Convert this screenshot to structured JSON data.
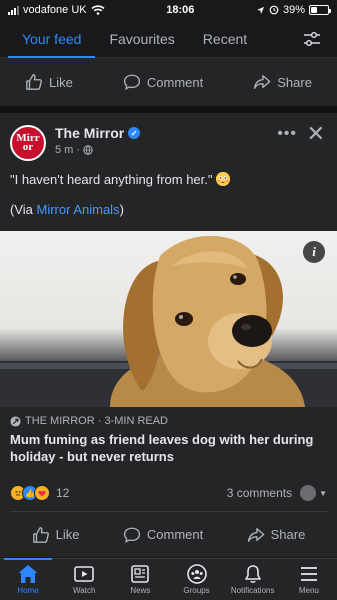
{
  "status_bar": {
    "carrier": "vodafone UK",
    "time": "18:06",
    "battery": "39%",
    "battery_level": 0.39
  },
  "tabs": [
    {
      "label": "Your feed",
      "active": true
    },
    {
      "label": "Favourites",
      "active": false
    },
    {
      "label": "Recent",
      "active": false
    }
  ],
  "actions": {
    "like": "Like",
    "comment": "Comment",
    "share": "Share"
  },
  "post": {
    "author": "The Mirror",
    "avatar_text": "Mirr\nor",
    "time": "5 m",
    "quote": "\"I haven't heard anything from her.\"",
    "via_prefix": "(Via ",
    "via_link": "Mirror Animals",
    "via_suffix": ")",
    "link_source": "THE MIRROR · 3-MIN READ",
    "headline": "Mum fuming as friend leaves dog with her during holiday - but never returns",
    "reaction_count": "12",
    "comments": "3 comments"
  },
  "bottom_nav": [
    {
      "label": "Home",
      "icon": "home-icon",
      "active": true
    },
    {
      "label": "Watch",
      "icon": "watch-icon",
      "active": false
    },
    {
      "label": "News",
      "icon": "news-icon",
      "active": false
    },
    {
      "label": "Groups",
      "icon": "groups-icon",
      "active": false
    },
    {
      "label": "Notifications",
      "icon": "bell-icon",
      "active": false
    },
    {
      "label": "Menu",
      "icon": "menu-icon",
      "active": false
    }
  ],
  "colors": {
    "accent": "#2d88ff",
    "background": "#18191a",
    "card": "#242526",
    "brand_red": "#c8102e"
  }
}
